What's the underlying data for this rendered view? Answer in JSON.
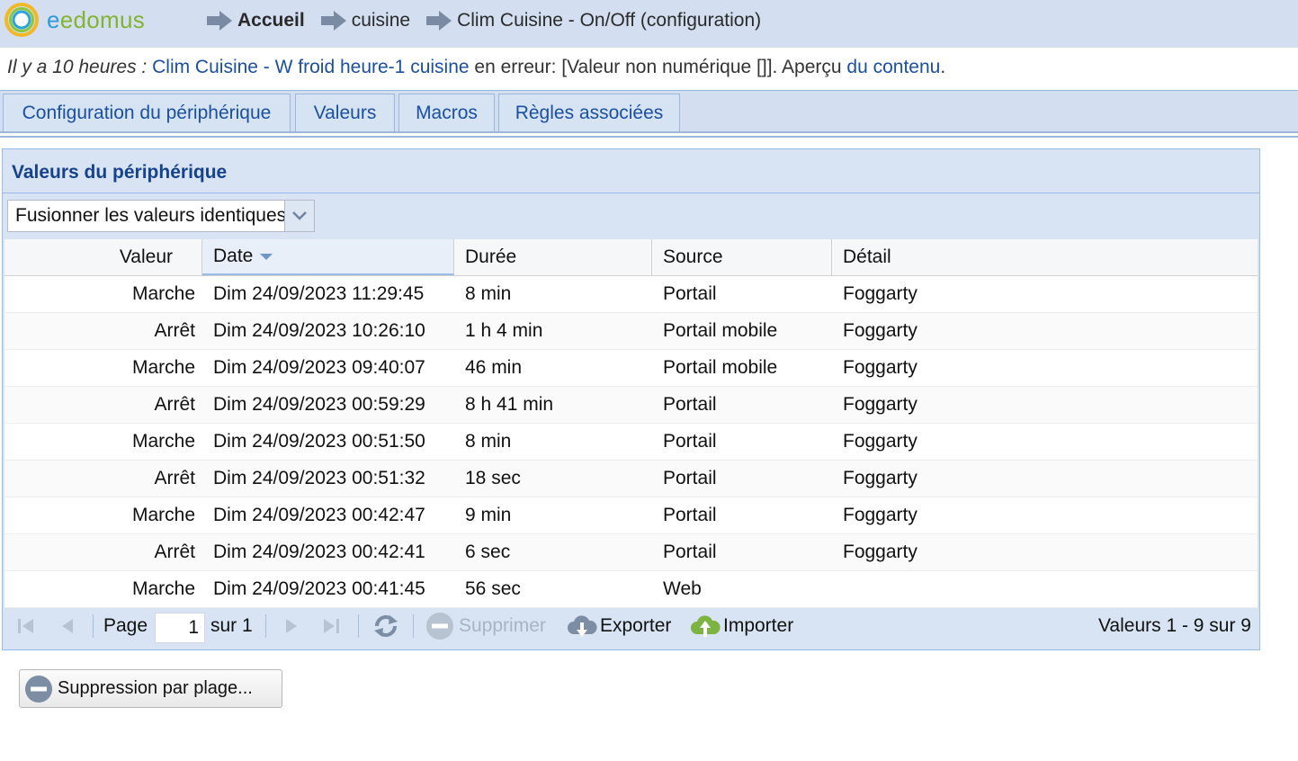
{
  "app": {
    "logo_text_e": "e",
    "logo_text_rest": "edomus"
  },
  "breadcrumb": [
    {
      "label": "Accueil"
    },
    {
      "label": "cuisine"
    },
    {
      "label": "Clim Cuisine - On/Off (configuration)"
    }
  ],
  "error": {
    "prefix": "Il y a 10 heures :",
    "link": "Clim Cuisine - W froid heure-1 cuisine",
    "middle": " en erreur: [Valeur non numérique []]. Aperçu ",
    "link2": "du contenu",
    "suffix": "."
  },
  "tabs": [
    {
      "label": "Configuration du périphérique"
    },
    {
      "label": "Valeurs"
    },
    {
      "label": "Macros"
    },
    {
      "label": "Règles associées"
    }
  ],
  "panel": {
    "title": "Valeurs du périphérique",
    "combo_value": "Fusionner les valeurs identiques"
  },
  "grid": {
    "columns": [
      "Valeur",
      "Date",
      "Durée",
      "Source",
      "Détail"
    ],
    "sorted_column": "Date",
    "rows": [
      [
        "Marche",
        "Dim 24/09/2023 11:29:45",
        "8 min",
        "Portail",
        "Foggarty"
      ],
      [
        "Arrêt",
        "Dim 24/09/2023 10:26:10",
        "1 h 4 min",
        "Portail mobile",
        "Foggarty"
      ],
      [
        "Marche",
        "Dim 24/09/2023 09:40:07",
        "46 min",
        "Portail mobile",
        "Foggarty"
      ],
      [
        "Arrêt",
        "Dim 24/09/2023 00:59:29",
        "8 h 41 min",
        "Portail",
        "Foggarty"
      ],
      [
        "Marche",
        "Dim 24/09/2023 00:51:50",
        "8 min",
        "Portail",
        "Foggarty"
      ],
      [
        "Arrêt",
        "Dim 24/09/2023 00:51:32",
        "18 sec",
        "Portail",
        "Foggarty"
      ],
      [
        "Marche",
        "Dim 24/09/2023 00:42:47",
        "9 min",
        "Portail",
        "Foggarty"
      ],
      [
        "Arrêt",
        "Dim 24/09/2023 00:42:41",
        "6 sec",
        "Portail",
        "Foggarty"
      ],
      [
        "Marche",
        "Dim 24/09/2023 00:41:45",
        "56 sec",
        "Web",
        ""
      ]
    ]
  },
  "toolbar": {
    "page_label": "Page",
    "page_value": "1",
    "page_total": "sur 1",
    "delete_label": "Supprimer",
    "export_label": "Exporter",
    "import_label": "Importer",
    "info": "Valeurs 1 - 9 sur 9"
  },
  "range_delete": {
    "label": "Suppression par plage..."
  },
  "colors": {
    "header_bg": "#d3dff0",
    "link": "#1b4fa0",
    "panel_title": "#15428b"
  }
}
